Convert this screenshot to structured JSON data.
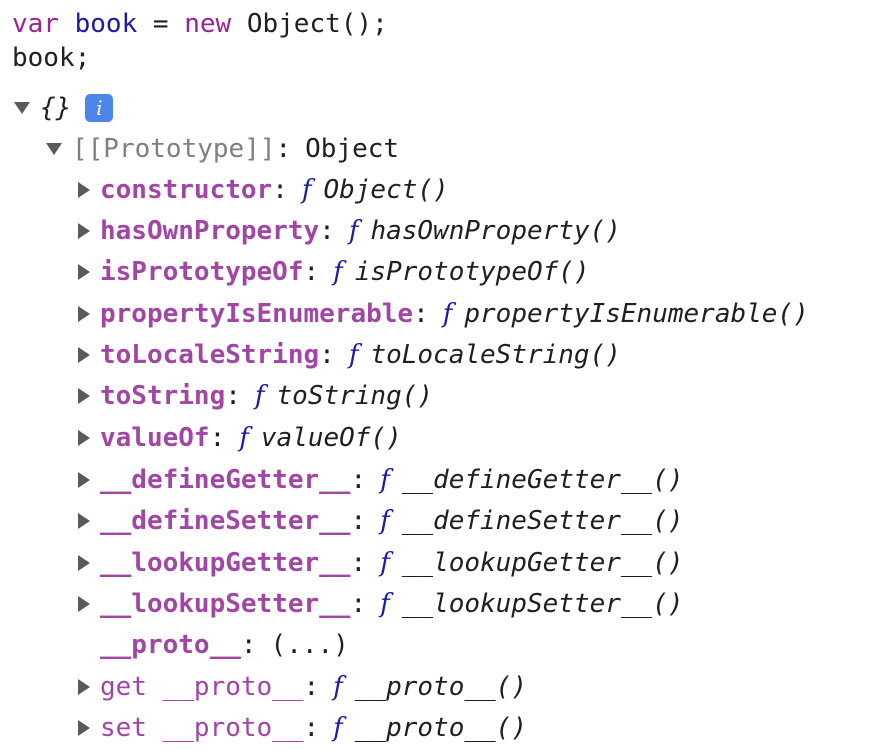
{
  "code": {
    "line1": {
      "kw_var": "var",
      "ident": "book",
      "eq": "=",
      "kw_new": "new",
      "expr": "Object();"
    },
    "line2": "book;"
  },
  "console": {
    "root_label": "{}",
    "info_badge": "i",
    "prototype_key": "[[Prototype]]",
    "prototype_colon": ":",
    "prototype_value": "Object",
    "properties": [
      {
        "key": "constructor",
        "colon": ":",
        "f": "f",
        "sig": "Object()"
      },
      {
        "key": "hasOwnProperty",
        "colon": ":",
        "f": "f",
        "sig": "hasOwnProperty()"
      },
      {
        "key": "isPrototypeOf",
        "colon": ":",
        "f": "f",
        "sig": "isPrototypeOf()"
      },
      {
        "key": "propertyIsEnumerable",
        "colon": ":",
        "f": "f",
        "sig": "propertyIsEnumerable()"
      },
      {
        "key": "toLocaleString",
        "colon": ":",
        "f": "f",
        "sig": "toLocaleString()"
      },
      {
        "key": "toString",
        "colon": ":",
        "f": "f",
        "sig": "toString()"
      },
      {
        "key": "valueOf",
        "colon": ":",
        "f": "f",
        "sig": "valueOf()"
      },
      {
        "key": "__defineGetter__",
        "colon": ":",
        "f": "f",
        "sig": "__defineGetter__()"
      },
      {
        "key": "__defineSetter__",
        "colon": ":",
        "f": "f",
        "sig": "__defineSetter__()"
      },
      {
        "key": "__lookupGetter__",
        "colon": ":",
        "f": "f",
        "sig": "__lookupGetter__()"
      },
      {
        "key": "__lookupSetter__",
        "colon": ":",
        "f": "f",
        "sig": "__lookupSetter__()"
      }
    ],
    "proto_accessor": {
      "key": "__proto__",
      "colon": ":",
      "value": "(...)"
    },
    "getter": {
      "key": "get __proto__",
      "colon": ":",
      "f": "f",
      "sig": "__proto__()"
    },
    "setter": {
      "key": "set __proto__",
      "colon": ":",
      "f": "f",
      "sig": "__proto__()"
    }
  },
  "colors": {
    "keyword": "#9b2393",
    "identifier": "#1a1aa6",
    "property_key": "#a246a6",
    "prototype_key": "#7f7f7f",
    "info_badge": "#4a87e8"
  }
}
